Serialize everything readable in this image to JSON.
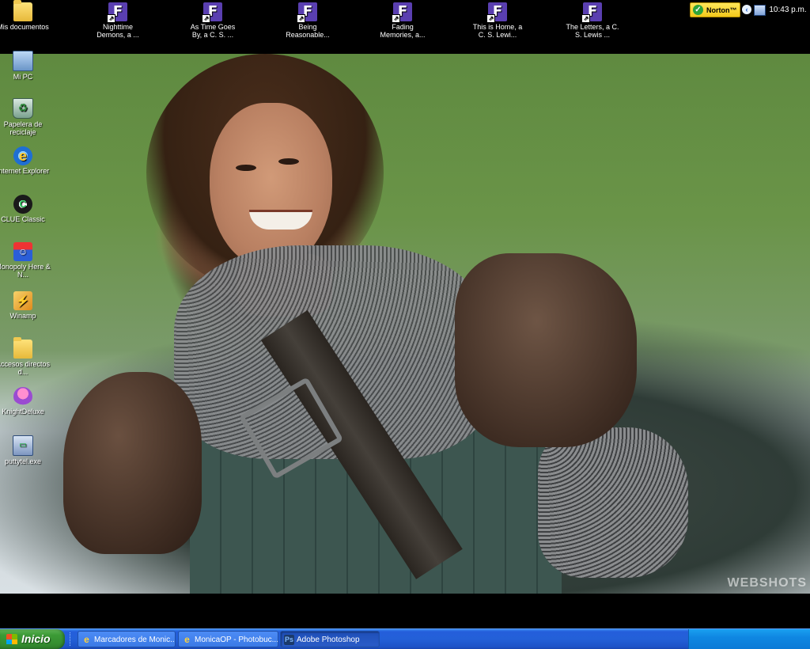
{
  "desktop": {
    "top_icons": [
      {
        "label": "Mis documentos",
        "icon": "folder-icon"
      },
      {
        "label": "Nighttime Demons, a ...",
        "icon": "shortcut-f-icon"
      },
      {
        "label": "As Time Goes By, a C. S. ...",
        "icon": "shortcut-f-icon"
      },
      {
        "label": "Being Reasonable...",
        "icon": "shortcut-f-icon"
      },
      {
        "label": "Fading Memories, a...",
        "icon": "shortcut-f-icon"
      },
      {
        "label": "This is Home, a C. S. Lewi...",
        "icon": "shortcut-f-icon"
      },
      {
        "label": "The Letters, a C. S. Lewis ...",
        "icon": "shortcut-f-icon"
      }
    ],
    "left_icons": [
      {
        "label": "Mi PC",
        "icon": "computer-icon"
      },
      {
        "label": "Papelera de reciclaje",
        "icon": "recycle-bin-icon"
      },
      {
        "label": "Internet Explorer",
        "icon": "internet-explorer-icon"
      },
      {
        "label": "CLUE Classic",
        "icon": "clue-icon"
      },
      {
        "label": "Monopoly Here & N...",
        "icon": "monopoly-icon"
      },
      {
        "label": "Winamp",
        "icon": "winamp-icon"
      },
      {
        "label": "Accesos directos d...",
        "icon": "folder-icon"
      },
      {
        "label": "KnightDeluxe",
        "icon": "knight-deluxe-icon"
      },
      {
        "label": "puttytel.exe",
        "icon": "putty-icon"
      }
    ],
    "watermark": "WEBSHOTS"
  },
  "taskbar": {
    "start_label": "Inicio",
    "tasks": [
      {
        "label": "Marcadores de Monic...",
        "icon": "internet-explorer-icon",
        "active": false
      },
      {
        "label": "MonicaOP - Photobuc...",
        "icon": "internet-explorer-icon",
        "active": false
      },
      {
        "label": "Adobe Photoshop",
        "icon": "photoshop-icon",
        "active": true
      }
    ],
    "tray": {
      "norton_label": "Norton™",
      "clock": "10:43 p.m."
    }
  }
}
